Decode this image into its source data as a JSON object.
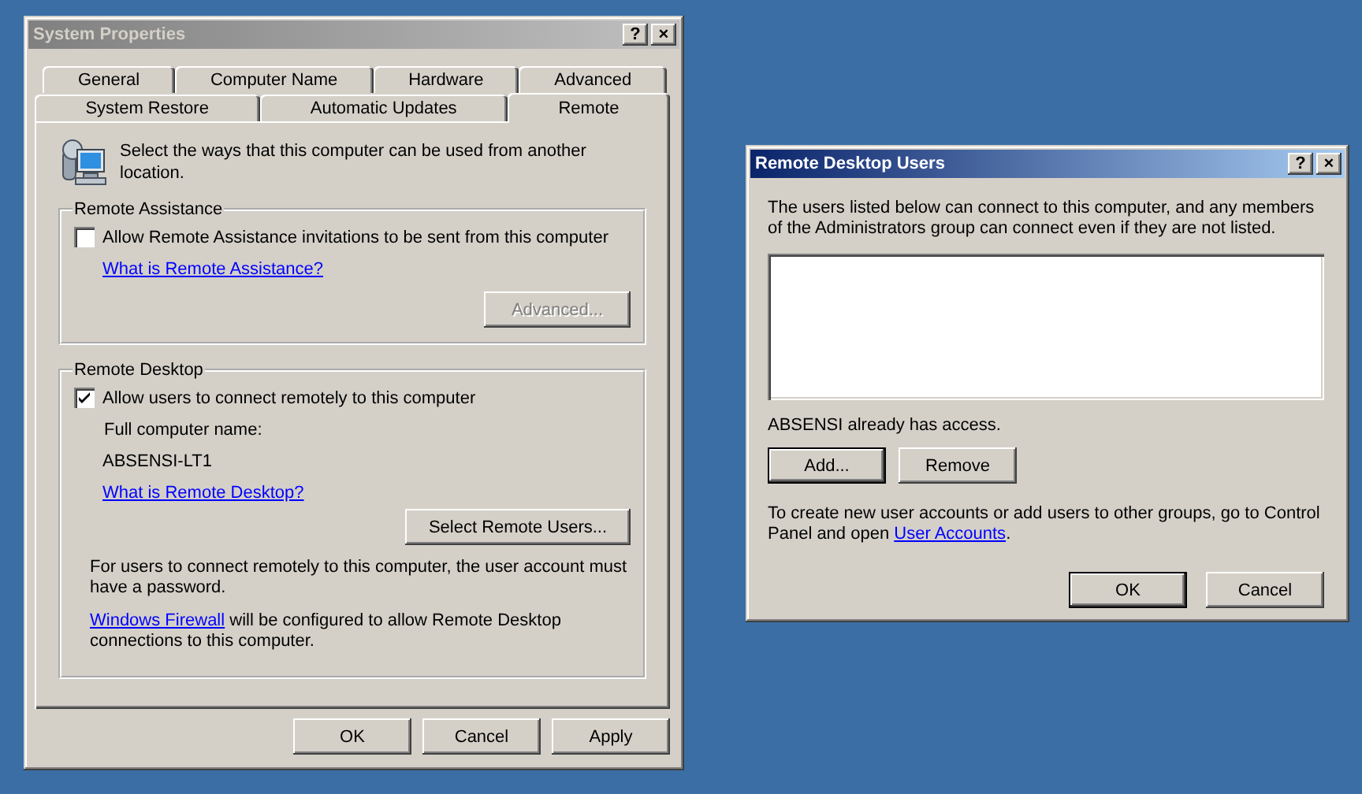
{
  "system_properties": {
    "title": "System Properties",
    "active": false,
    "title_buttons": [
      "?",
      "×"
    ],
    "tab_rows": [
      [
        {
          "label": "General",
          "selected": false
        },
        {
          "label": "Computer Name",
          "selected": false
        },
        {
          "label": "Hardware",
          "selected": false
        },
        {
          "label": "Advanced",
          "selected": false
        }
      ],
      [
        {
          "label": "System Restore",
          "selected": false
        },
        {
          "label": "Automatic Updates",
          "selected": false
        },
        {
          "label": "Remote",
          "selected": true
        }
      ]
    ],
    "intro": "Select the ways that this computer can be used from another location.",
    "remote_assistance": {
      "legend": "Remote Assistance",
      "checkbox": {
        "label": "Allow Remote Assistance invitations to be sent from this computer",
        "checked": false
      },
      "link": "What is Remote Assistance?",
      "button": {
        "label": "Advanced...",
        "disabled": true
      }
    },
    "remote_desktop": {
      "legend": "Remote Desktop",
      "checkbox": {
        "label": "Allow users to connect remotely to this computer",
        "checked": true
      },
      "computer_name_label": "Full computer name:",
      "computer_name": "ABSENSI-LT1",
      "link": "What is Remote Desktop?",
      "button": {
        "label": "Select Remote Users...",
        "disabled": false
      },
      "password_note": "For users to connect remotely to this computer, the user account must have a password.",
      "firewall_note": {
        "link": "Windows Firewall",
        "after": " will be configured to allow Remote Desktop connections to this computer."
      }
    },
    "buttons": [
      {
        "label": "OK",
        "default": false
      },
      {
        "label": "Cancel",
        "default": false
      },
      {
        "label": "Apply",
        "default": false
      }
    ]
  },
  "remote_desktop_users": {
    "title": "Remote Desktop Users",
    "active": true,
    "title_buttons": [
      "?",
      "×"
    ],
    "description": "The users listed below can connect to this computer, and any members of the Administrators group can connect even if they are not listed.",
    "status": "ABSENSI already has access.",
    "list_buttons": [
      {
        "label": "Add...",
        "default": true
      },
      {
        "label": "Remove",
        "default": false
      }
    ],
    "note": {
      "before": "To create new user accounts or add users to other groups, go to Control Panel and open ",
      "link": "User Accounts",
      "after": "."
    },
    "buttons": [
      {
        "label": "OK",
        "default": true
      },
      {
        "label": "Cancel",
        "default": false
      }
    ]
  }
}
